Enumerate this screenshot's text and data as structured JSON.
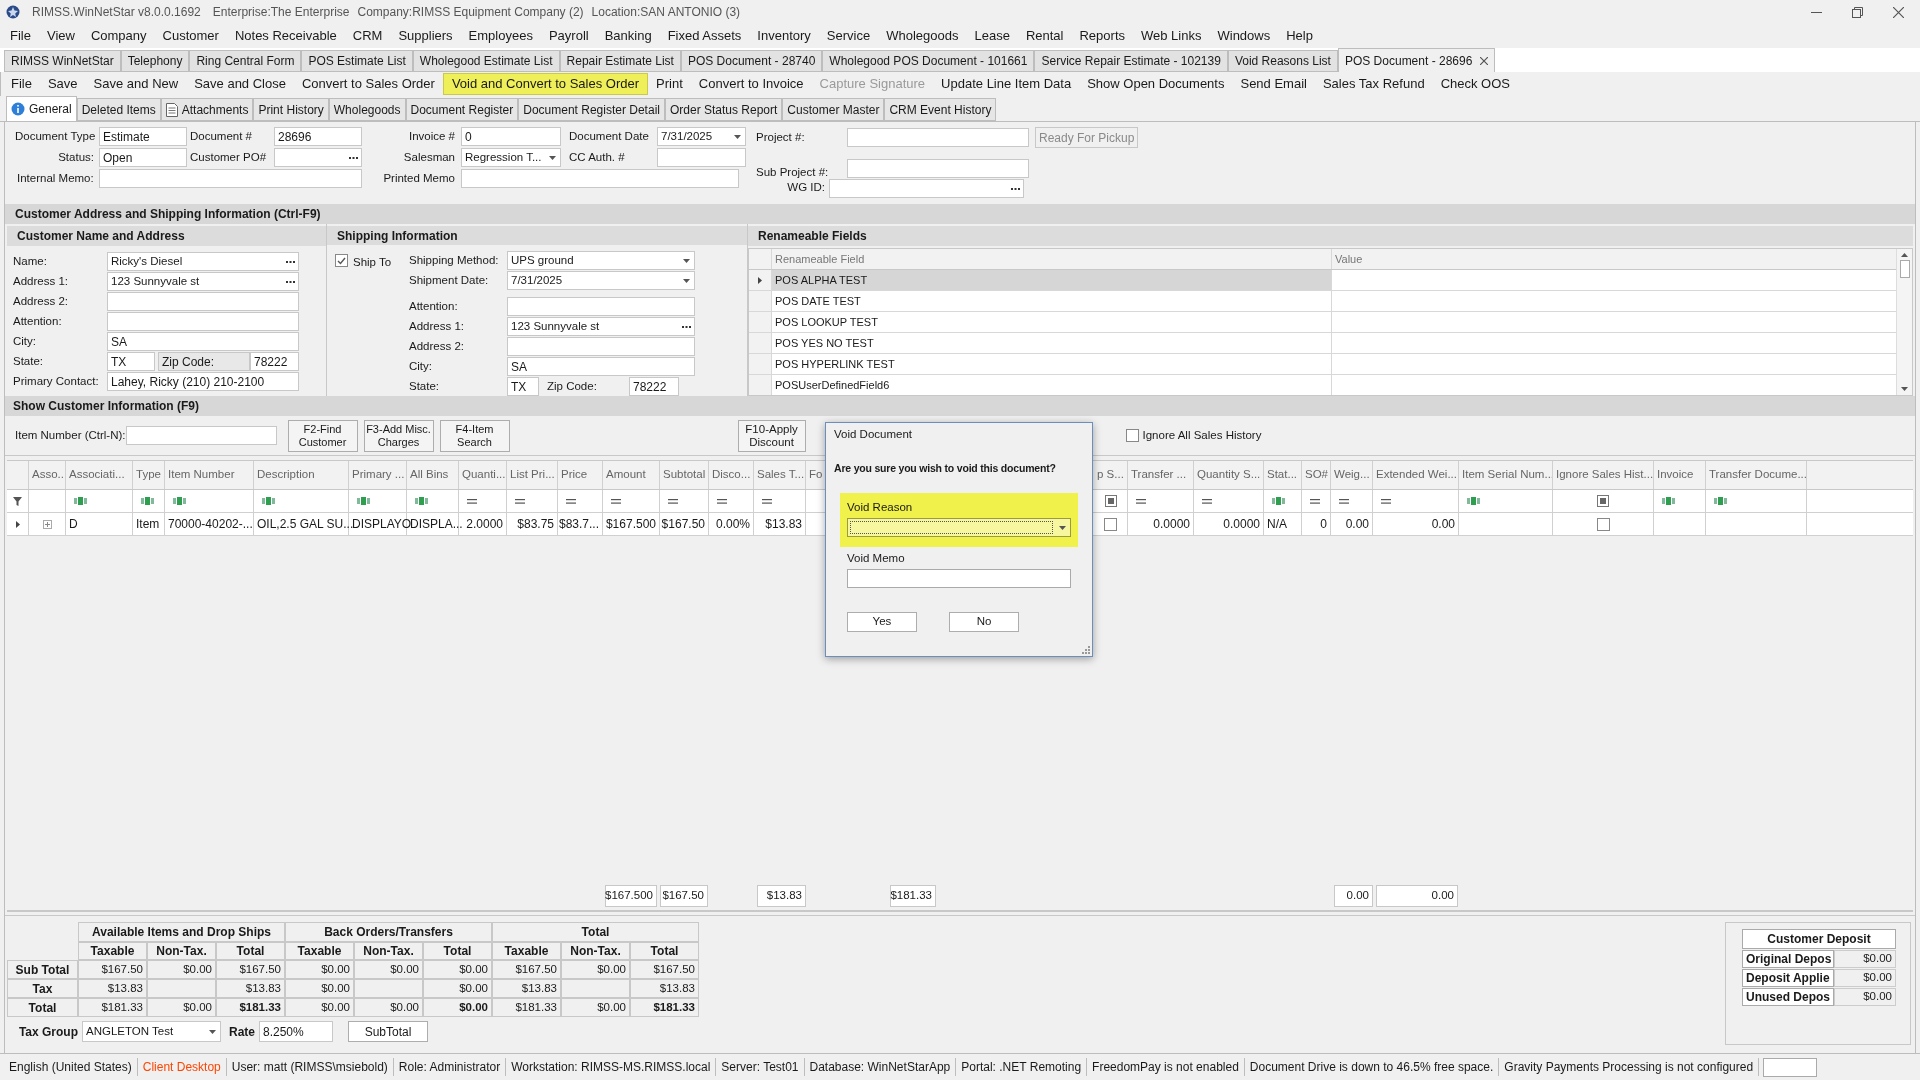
{
  "window": {
    "title": "RIMSS.WinNetStar v8.0.0.1692",
    "enterprise": "Enterprise:The Enterprise",
    "company": "Company:RIMSS Equipment Company (2)",
    "location": "Location:SAN ANTONIO (3)"
  },
  "menu": [
    "File",
    "View",
    "Company",
    "Customer",
    "Notes Receivable",
    "CRM",
    "Suppliers",
    "Employees",
    "Payroll",
    "Banking",
    "Fixed Assets",
    "Inventory",
    "Service",
    "Wholegoods",
    "Lease",
    "Rental",
    "Reports",
    "Web Links",
    "Windows",
    "Help"
  ],
  "document_tabs": [
    {
      "label": "RIMSS WinNetStar",
      "selected": false,
      "closable": false
    },
    {
      "label": "Telephony",
      "selected": false,
      "closable": false
    },
    {
      "label": "Ring Central Form",
      "selected": false,
      "closable": false
    },
    {
      "label": "POS Estimate List",
      "selected": false,
      "closable": false
    },
    {
      "label": "Wholegood Estimate List",
      "selected": false,
      "closable": false
    },
    {
      "label": "Repair Estimate List",
      "selected": false,
      "closable": false
    },
    {
      "label": "POS Document - 28740",
      "selected": false,
      "closable": false
    },
    {
      "label": "Wholegood POS Document - 101661",
      "selected": false,
      "closable": false
    },
    {
      "label": "Service Repair Estimate - 102139",
      "selected": false,
      "closable": false
    },
    {
      "label": "Void Reasons List",
      "selected": false,
      "closable": false
    },
    {
      "label": "POS Document - 28696",
      "selected": true,
      "closable": true
    }
  ],
  "toolbar": [
    {
      "label": "File",
      "highlighted": false,
      "disabled": false
    },
    {
      "label": "Save",
      "highlighted": false,
      "disabled": false
    },
    {
      "label": "Save and New",
      "highlighted": false,
      "disabled": false
    },
    {
      "label": "Save and Close",
      "highlighted": false,
      "disabled": false
    },
    {
      "label": "Convert to Sales Order",
      "highlighted": false,
      "disabled": false
    },
    {
      "label": "Void and Convert to Sales Order",
      "highlighted": true,
      "disabled": false
    },
    {
      "label": "Print",
      "highlighted": false,
      "disabled": false
    },
    {
      "label": "Convert to Invoice",
      "highlighted": false,
      "disabled": false
    },
    {
      "label": "Capture Signature",
      "highlighted": false,
      "disabled": true
    },
    {
      "label": "Update Line Item Data",
      "highlighted": false,
      "disabled": false
    },
    {
      "label": "Show Open Documents",
      "highlighted": false,
      "disabled": false
    },
    {
      "label": "Send Email",
      "highlighted": false,
      "disabled": false
    },
    {
      "label": "Sales Tax Refund",
      "highlighted": false,
      "disabled": false
    },
    {
      "label": "Check OOS",
      "highlighted": false,
      "disabled": false
    }
  ],
  "subtabs": [
    {
      "label": "General",
      "selected": true,
      "kind": "info"
    },
    {
      "label": "Deleted Items",
      "selected": false,
      "kind": "plain"
    },
    {
      "label": "Attachments",
      "selected": false,
      "kind": "document"
    },
    {
      "label": "Print History",
      "selected": false,
      "kind": "plain"
    },
    {
      "label": "Wholegoods",
      "selected": false,
      "kind": "plain"
    },
    {
      "label": "Document Register",
      "selected": false,
      "kind": "plain"
    },
    {
      "label": "Document Register Detail",
      "selected": false,
      "kind": "plain"
    },
    {
      "label": "Order Status Report",
      "selected": false,
      "kind": "plain"
    },
    {
      "label": "Customer Master",
      "selected": false,
      "kind": "plain"
    },
    {
      "label": "CRM Event History",
      "selected": false,
      "kind": "plain"
    }
  ],
  "header_form": {
    "document_type": {
      "label": "Document Type",
      "value": "Estimate"
    },
    "document_number": {
      "label": "Document #",
      "value": "28696"
    },
    "invoice": {
      "label": "Invoice #",
      "value": "0"
    },
    "document_date": {
      "label": "Document Date",
      "value": "7/31/2025"
    },
    "status": {
      "label": "Status:",
      "value": "Open"
    },
    "customer_po": {
      "label": "Customer PO#"
    },
    "salesman": {
      "label": "Salesman",
      "value": "Regression T..."
    },
    "cc_auth": {
      "label": "CC Auth. #"
    },
    "internal_memo": {
      "label": "Internal Memo:"
    },
    "printed_memo": {
      "label": "Printed Memo"
    },
    "project": {
      "label": "Project #:"
    },
    "sub_project": {
      "label": "Sub Project #:"
    },
    "wg_id": {
      "label": "WG ID:"
    },
    "ready_button": {
      "label": "Ready For Pickup",
      "disabled": true
    }
  },
  "address_section": {
    "title": "Customer Address and Shipping Information (Ctrl-F9)"
  },
  "customer": {
    "title": "Customer Name and Address",
    "fields": [
      {
        "kind": "lookup",
        "label": "Name:",
        "value": "Ricky's Diesel"
      },
      {
        "kind": "lookup",
        "label": "Address 1:",
        "value": "123 Sunnyvale st"
      },
      {
        "kind": "text",
        "label": "Address 2:"
      },
      {
        "kind": "text",
        "label": "Attention:"
      },
      {
        "kind": "text",
        "label": "City:",
        "value": "SA"
      },
      {
        "kind": "state_zip",
        "label": "State:",
        "value": "TX",
        "zip_label": "Zip Code:",
        "zip_value": "78222"
      },
      {
        "kind": "text",
        "label": "Primary Contact:",
        "value": "Lahey, Ricky (210) 210-2100"
      }
    ]
  },
  "shipping": {
    "title": "Shipping Information",
    "ship_to": {
      "label": "Ship To",
      "checked": true
    },
    "fields": [
      {
        "kind": "dropdown",
        "label": "Shipping Method:",
        "value": "UPS ground"
      },
      {
        "kind": "dropdown",
        "label": "Shipment Date:",
        "value": "7/31/2025"
      },
      {
        "kind": "text",
        "label": "Attention:"
      },
      {
        "kind": "lookup",
        "label": "Address 1:",
        "value": "123 Sunnyvale st"
      },
      {
        "kind": "text",
        "label": "Address 2:"
      },
      {
        "kind": "text",
        "label": "City:",
        "value": "SA"
      },
      {
        "kind": "state_zip",
        "label": "State:",
        "value": "TX",
        "zip_label": "Zip Code:",
        "zip_value": "78222"
      }
    ]
  },
  "renameable": {
    "title": "Renameable Fields",
    "columns": [
      "Renameable Field",
      "Value"
    ],
    "rows": [
      {
        "field": "POS ALPHA TEST",
        "selected": true
      },
      {
        "field": "POS DATE TEST",
        "selected": false
      },
      {
        "field": "POS LOOKUP TEST",
        "selected": false
      },
      {
        "field": "POS YES NO TEST",
        "selected": false
      },
      {
        "field": "POS HYPERLINK TEST",
        "selected": false
      },
      {
        "field": "POSUserDefinedField6",
        "selected": false
      }
    ]
  },
  "customer_info": {
    "title": "Show Customer Information (F9)"
  },
  "item_entry": {
    "label": "Item Number (Ctrl-N):",
    "buttons": [
      "F2-Find Customer",
      "F3-Add Misc. Charges",
      "F4-Item Search"
    ],
    "discount_button": "F10-Apply Discount",
    "ignore_history": {
      "label": "Ignore All Sales History",
      "checked": false
    }
  },
  "grid": {
    "columns": [
      {
        "label": "Asso...",
        "kind": "none"
      },
      {
        "label": "Associati...",
        "kind": "text"
      },
      {
        "label": "Type",
        "kind": "text"
      },
      {
        "label": "Item Number",
        "kind": "text"
      },
      {
        "label": "Description",
        "kind": "text"
      },
      {
        "label": "Primary ...",
        "kind": "text"
      },
      {
        "label": "All Bins",
        "kind": "text"
      },
      {
        "label": "Quanti...",
        "kind": "number"
      },
      {
        "label": "List Pri...",
        "kind": "number"
      },
      {
        "label": "Price",
        "kind": "number"
      },
      {
        "label": "Amount",
        "kind": "number"
      },
      {
        "label": "Subtotal",
        "kind": "number"
      },
      {
        "label": "Disco...",
        "kind": "number"
      },
      {
        "label": "Sales T...",
        "kind": "number"
      },
      {
        "label": "Fo",
        "kind": "none"
      },
      {
        "label": "p S...",
        "kind": "bool"
      },
      {
        "label": "Transfer ...",
        "kind": "number"
      },
      {
        "label": "Quantity S...",
        "kind": "number"
      },
      {
        "label": "Stat...",
        "kind": "text"
      },
      {
        "label": "SO#",
        "kind": "number"
      },
      {
        "label": "Weig...",
        "kind": "number"
      },
      {
        "label": "Extended Wei...",
        "kind": "number"
      },
      {
        "label": "Item Serial Num...",
        "kind": "text"
      },
      {
        "label": "Ignore Sales Hist...",
        "kind": "bool"
      },
      {
        "label": "Invoice",
        "kind": "text"
      },
      {
        "label": "Transfer Docume...",
        "kind": "text"
      }
    ],
    "rows": [
      {
        "current": true,
        "cells": [
          {
            "kind": "expander",
            "expanded": false
          },
          {
            "kind": "text",
            "text": "D"
          },
          {
            "kind": "text",
            "text": "Item"
          },
          {
            "kind": "text",
            "text": "70000-40202-..."
          },
          {
            "kind": "text",
            "text": "OIL,2.5 GAL SU..."
          },
          {
            "kind": "text",
            "text": "DISPLAYO"
          },
          {
            "kind": "text",
            "text": "DISPLA..."
          },
          {
            "kind": "text",
            "text": "2.0000"
          },
          {
            "kind": "text",
            "text": "$83.75"
          },
          {
            "kind": "text",
            "text": "$83.7..."
          },
          {
            "kind": "text",
            "text": "$167.500"
          },
          {
            "kind": "text",
            "text": "$167.50"
          },
          {
            "kind": "text",
            "text": "0.00%"
          },
          {
            "kind": "text",
            "text": "$13.83"
          },
          {
            "kind": "empty"
          },
          {
            "kind": "check",
            "checked": false
          },
          {
            "kind": "text",
            "text": "0.0000"
          },
          {
            "kind": "text",
            "text": "0.0000"
          },
          {
            "kind": "text",
            "text": "N/A"
          },
          {
            "kind": "text",
            "text": "0"
          },
          {
            "kind": "text",
            "text": "0.00"
          },
          {
            "kind": "text",
            "text": "0.00"
          },
          {
            "kind": "empty"
          },
          {
            "kind": "check",
            "checked": false
          },
          {
            "kind": "empty"
          },
          {
            "kind": "empty"
          }
        ]
      }
    ],
    "totals": [
      "$167.500",
      "$167.50",
      "$13.83",
      "$181.33",
      "0.00",
      "0.00"
    ]
  },
  "dialog": {
    "title": "Void Document",
    "question": "Are you sure you wish to void this document?",
    "reason_label": "Void Reason",
    "memo_label": "Void Memo",
    "buttons": [
      "Yes",
      "No"
    ]
  },
  "summary": {
    "groups": [
      "Available Items and Drop Ships",
      "Back Orders/Transfers",
      "Total"
    ],
    "subheaders": [
      "Taxable",
      "Non-Tax.",
      "Total",
      "Taxable",
      "Non-Tax.",
      "Total",
      "Taxable",
      "Non-Tax.",
      "Total"
    ],
    "rows": [
      {
        "label": "Sub Total",
        "cells": [
          {
            "text": "$167.50",
            "emphasis": false
          },
          {
            "text": "$0.00",
            "emphasis": false
          },
          {
            "text": "$167.50",
            "emphasis": false
          },
          {
            "text": "$0.00",
            "emphasis": false
          },
          {
            "text": "$0.00",
            "emphasis": false
          },
          {
            "text": "$0.00",
            "emphasis": false
          },
          {
            "text": "$167.50",
            "emphasis": false
          },
          {
            "text": "$0.00",
            "emphasis": false
          },
          {
            "text": "$167.50",
            "emphasis": false
          }
        ]
      },
      {
        "label": "Tax",
        "cells": [
          {
            "text": "$13.83",
            "emphasis": false
          },
          null,
          {
            "text": "$13.83",
            "emphasis": false
          },
          {
            "text": "$0.00",
            "emphasis": false
          },
          null,
          {
            "text": "$0.00",
            "emphasis": false
          },
          {
            "text": "$13.83",
            "emphasis": false
          },
          null,
          {
            "text": "$13.83",
            "emphasis": false
          }
        ]
      },
      {
        "label": "Total",
        "cells": [
          {
            "text": "$181.33",
            "emphasis": false
          },
          {
            "text": "$0.00",
            "emphasis": false
          },
          {
            "text": "$181.33",
            "emphasis": true
          },
          {
            "text": "$0.00",
            "emphasis": false
          },
          {
            "text": "$0.00",
            "emphasis": false
          },
          {
            "text": "$0.00",
            "emphasis": true
          },
          {
            "text": "$181.33",
            "emphasis": false
          },
          {
            "text": "$0.00",
            "emphasis": false
          },
          {
            "text": "$181.33",
            "emphasis": true
          }
        ]
      }
    ],
    "tax_group": {
      "label": "Tax Group",
      "value": "ANGLETON Test",
      "rate_label": "Rate",
      "rate": "8.250%",
      "button": "SubTotal"
    }
  },
  "customer_deposit": {
    "title": "Customer Deposit",
    "rows": [
      {
        "label": "Original Depos",
        "value": "$0.00"
      },
      {
        "label": "Deposit Applie",
        "value": "$0.00"
      },
      {
        "label": "Unused Depos",
        "value": "$0.00"
      }
    ]
  },
  "status_bar": [
    {
      "text": "English (United States)",
      "color": "#1a1a1a"
    },
    {
      "text": "Client Desktop",
      "color": "#ff4500"
    },
    {
      "text": "User: matt (RIMSS\\msiebold)",
      "color": "#1a1a1a"
    },
    {
      "text": "Role: Administrator",
      "color": "#1a1a1a"
    },
    {
      "text": "Workstation: RIMSS-MS.RIMSS.local",
      "color": "#1a1a1a"
    },
    {
      "text": "Server: Test01",
      "color": "#1a1a1a"
    },
    {
      "text": "Database: WinNetStarApp",
      "color": "#1a1a1a"
    },
    {
      "text": "Portal: .NET Remoting",
      "color": "#1a1a1a"
    },
    {
      "text": "FreedomPay is not enabled",
      "color": "#1a1a1a"
    },
    {
      "text": "Document Drive is down to 46.5% free space.",
      "color": "#1a1a1a"
    },
    {
      "text": "Gravity Payments Processing is not configured",
      "color": "#1a1a1a"
    }
  ]
}
